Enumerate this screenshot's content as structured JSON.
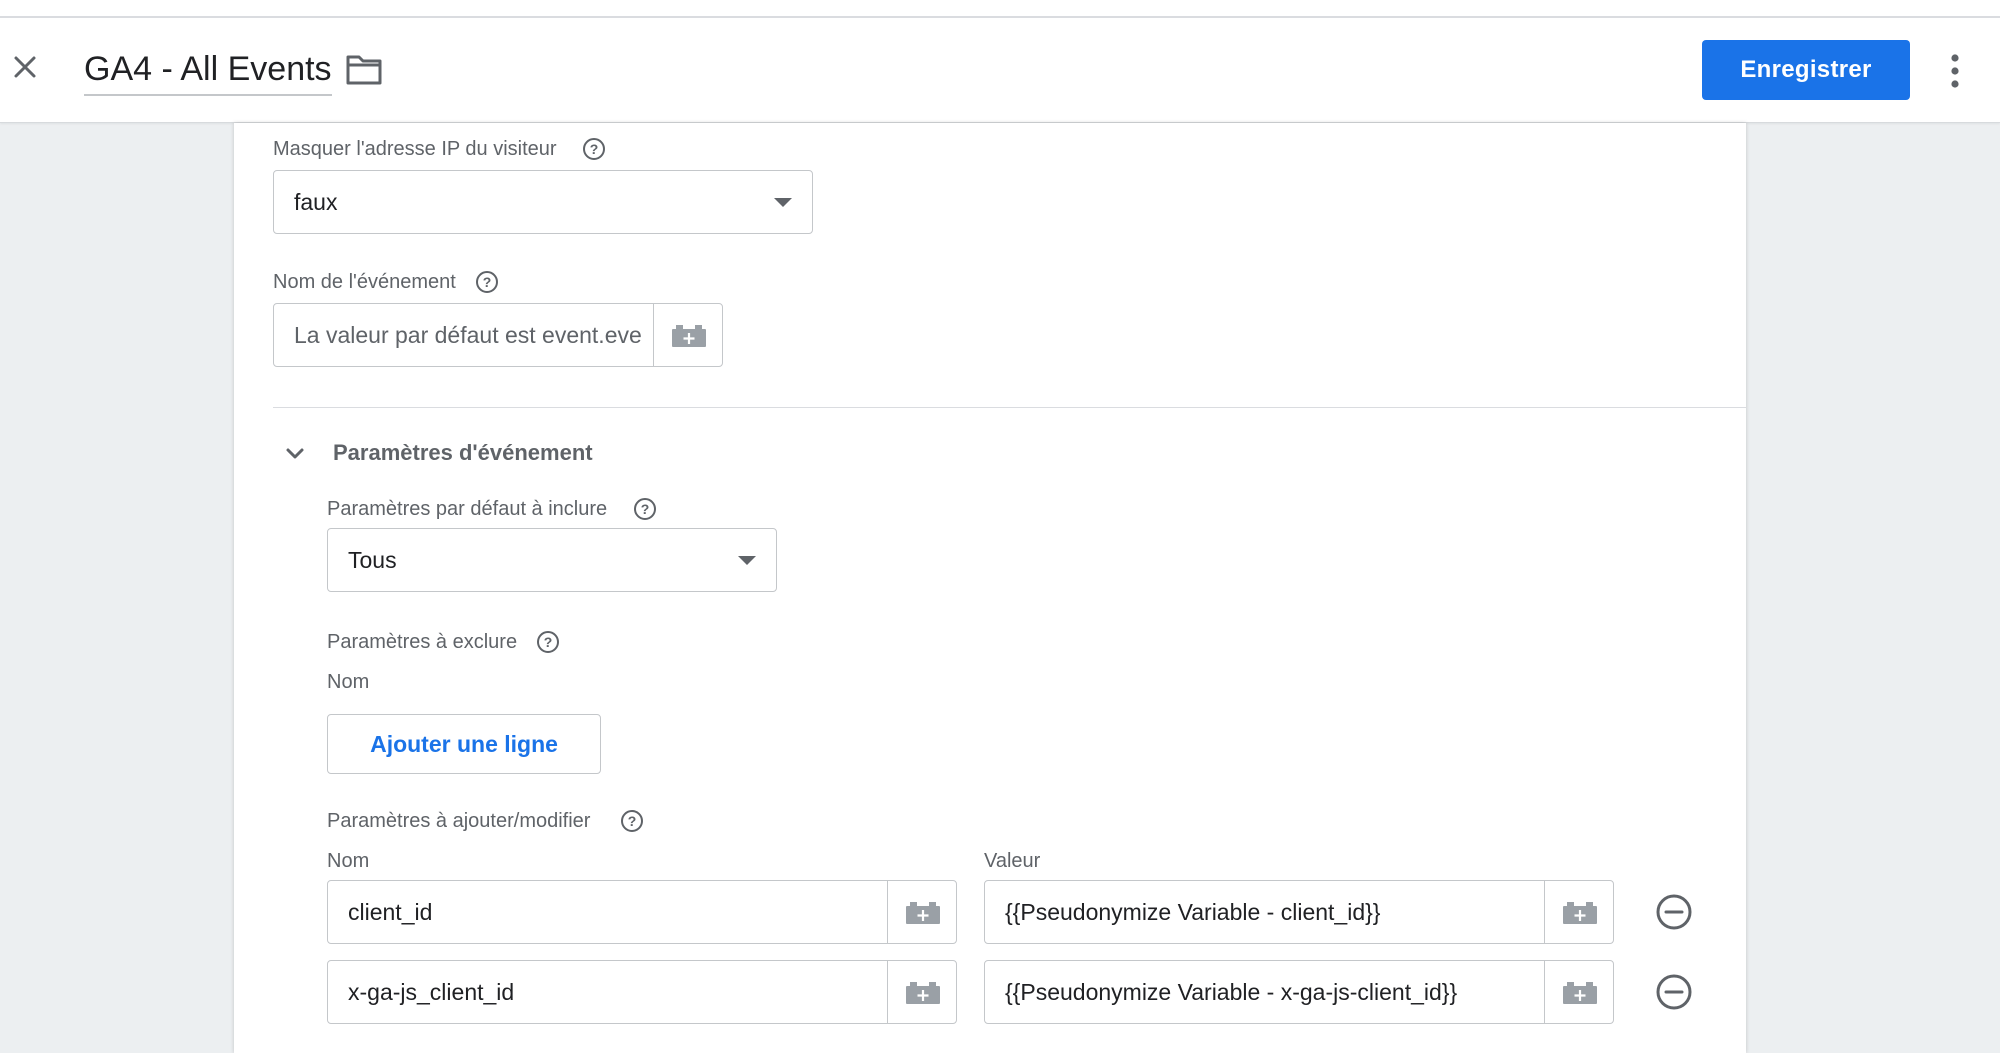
{
  "header": {
    "title": "GA4 - All Events",
    "save_label": "Enregistrer",
    "close_icon": "close-icon",
    "folder_icon": "folder-icon",
    "more_icon": "more-vert-icon"
  },
  "colors": {
    "accent": "#1a73e8",
    "background": "#eceff1",
    "card": "#ffffff"
  },
  "form": {
    "ip_anon": {
      "label": "Masquer l'adresse IP du visiteur",
      "value": "faux"
    },
    "event_name": {
      "label": "Nom de l'événement",
      "placeholder": "La valeur par défaut est event.eve"
    },
    "event_params": {
      "section_title": "Paramètres d'événement",
      "default_params": {
        "label": "Paramètres par défaut à inclure",
        "value": "Tous"
      },
      "exclude": {
        "label": "Paramètres à exclure",
        "name_header": "Nom",
        "add_row_label": "Ajouter une ligne"
      },
      "add_modify": {
        "label": "Paramètres à ajouter/modifier",
        "name_header": "Nom",
        "value_header": "Valeur",
        "rows": [
          {
            "name": "client_id",
            "value": "{{Pseudonymize Variable - client_id}}"
          },
          {
            "name": "x-ga-js_client_id",
            "value": "{{Pseudonymize Variable - x-ga-js-client_id}}"
          }
        ]
      }
    }
  }
}
